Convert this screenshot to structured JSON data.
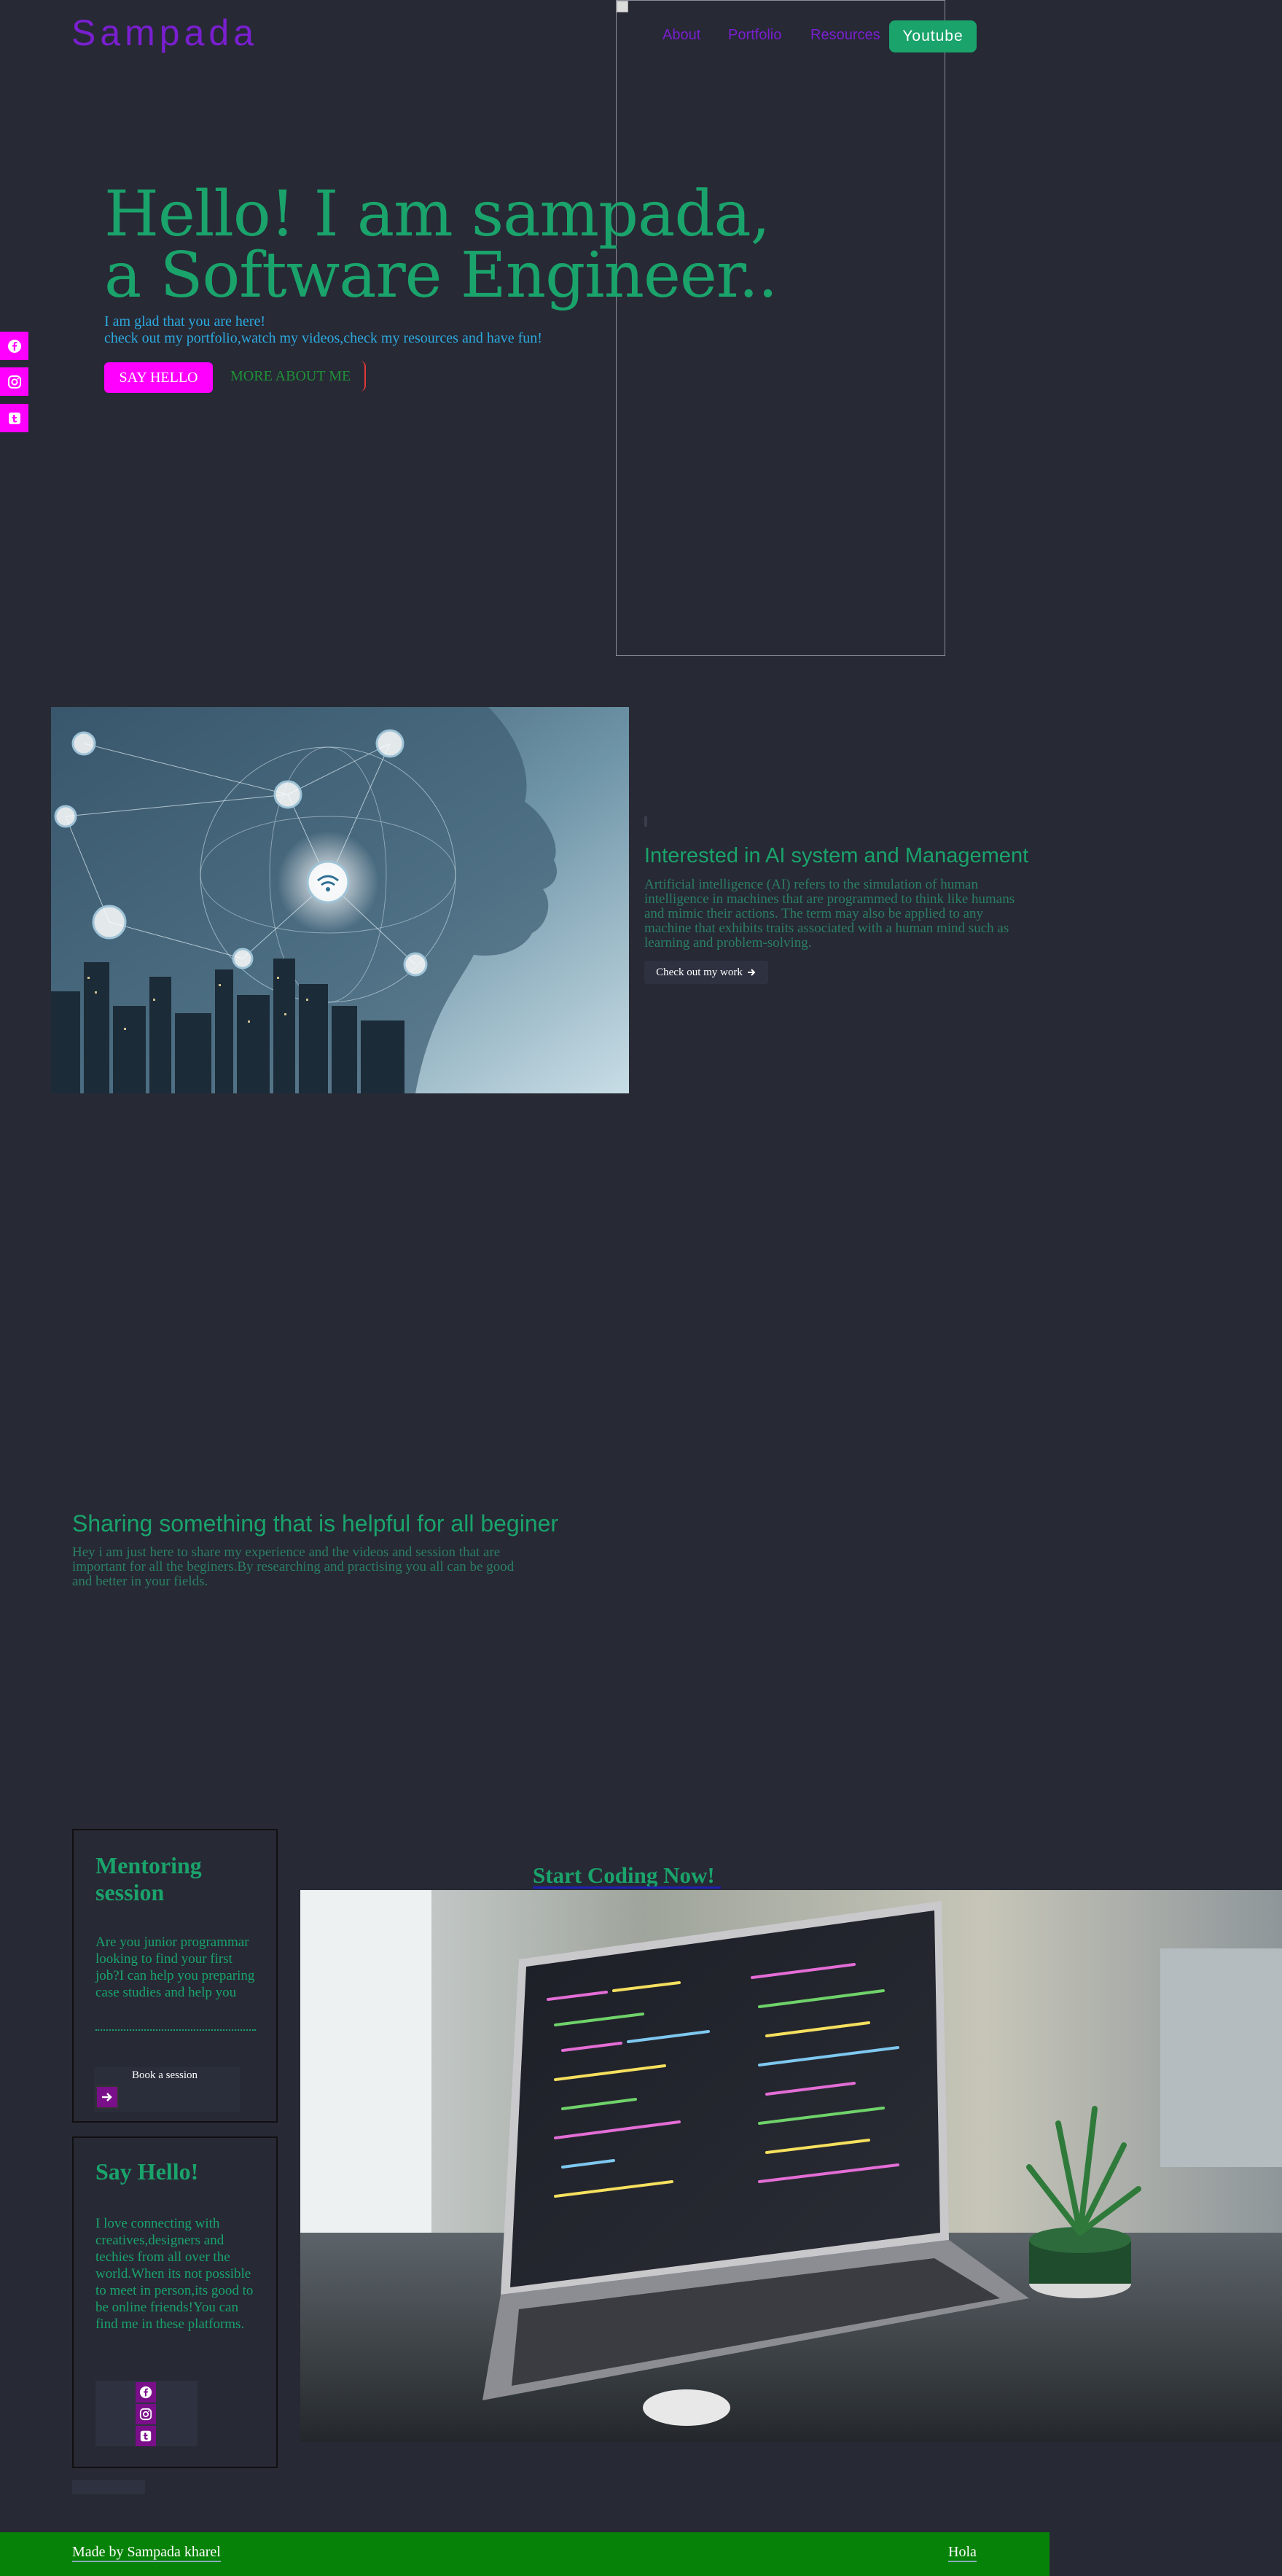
{
  "header": {
    "logo": "Sampada",
    "nav": [
      {
        "label": "About"
      },
      {
        "label": "Portfolio"
      },
      {
        "label": "Resources"
      }
    ],
    "youtube_button": "Youtube"
  },
  "social_rail": {
    "icons": [
      "facebook-icon",
      "instagram-icon",
      "tumblr-icon"
    ],
    "color": "#ff00ff"
  },
  "hero": {
    "title_line1": "Hello! I am sampada,",
    "title_line2": "a Software Engineer..",
    "subtitle_line1": "I am glad that you are here!",
    "subtitle_line2": "check out my portfolio,watch my videos,check my resources and have fun!",
    "say_hello": "SAY HELLO",
    "more_about": "MORE ABOUT ME"
  },
  "ai_section": {
    "title": "Interested in AI system and Management",
    "text": "Artificial intelligence (AI) refers to the simulation of human intelligence in machines that are programmed to think like humans and mimic their actions. The term may also be applied to any machine that exhibits traits associated with a human mind such as learning and problem-solving.",
    "button": "Check out my work"
  },
  "sharing": {
    "title": "Sharing something that is helpful for all beginer",
    "text": "Hey i am just here to share my experience and the videos and session that are important for all the beginers.By researching and practising you all can be good and better in your fields."
  },
  "mentoring_card": {
    "title_line1": "Mentoring",
    "title_line2": "session",
    "text": "Are you junior programmar looking to find your first job?I can help you preparing case studies and help you",
    "button": "Book a session"
  },
  "hello_card": {
    "title": "Say Hello!",
    "text": "I love connecting with creatives,designers and techies from all over the world.When its not possible to meet in person,its good to be online friends!You can find me in these platforms."
  },
  "coding": {
    "title": "Start Coding Now!"
  },
  "footer": {
    "left": "Made by Sampada kharel",
    "right": "Hola",
    "color": "#078208"
  },
  "colors": {
    "background": "#272935",
    "accent_green": "#1aa36b",
    "accent_purple": "#7a1fd0",
    "accent_magenta": "#ff00ff"
  }
}
